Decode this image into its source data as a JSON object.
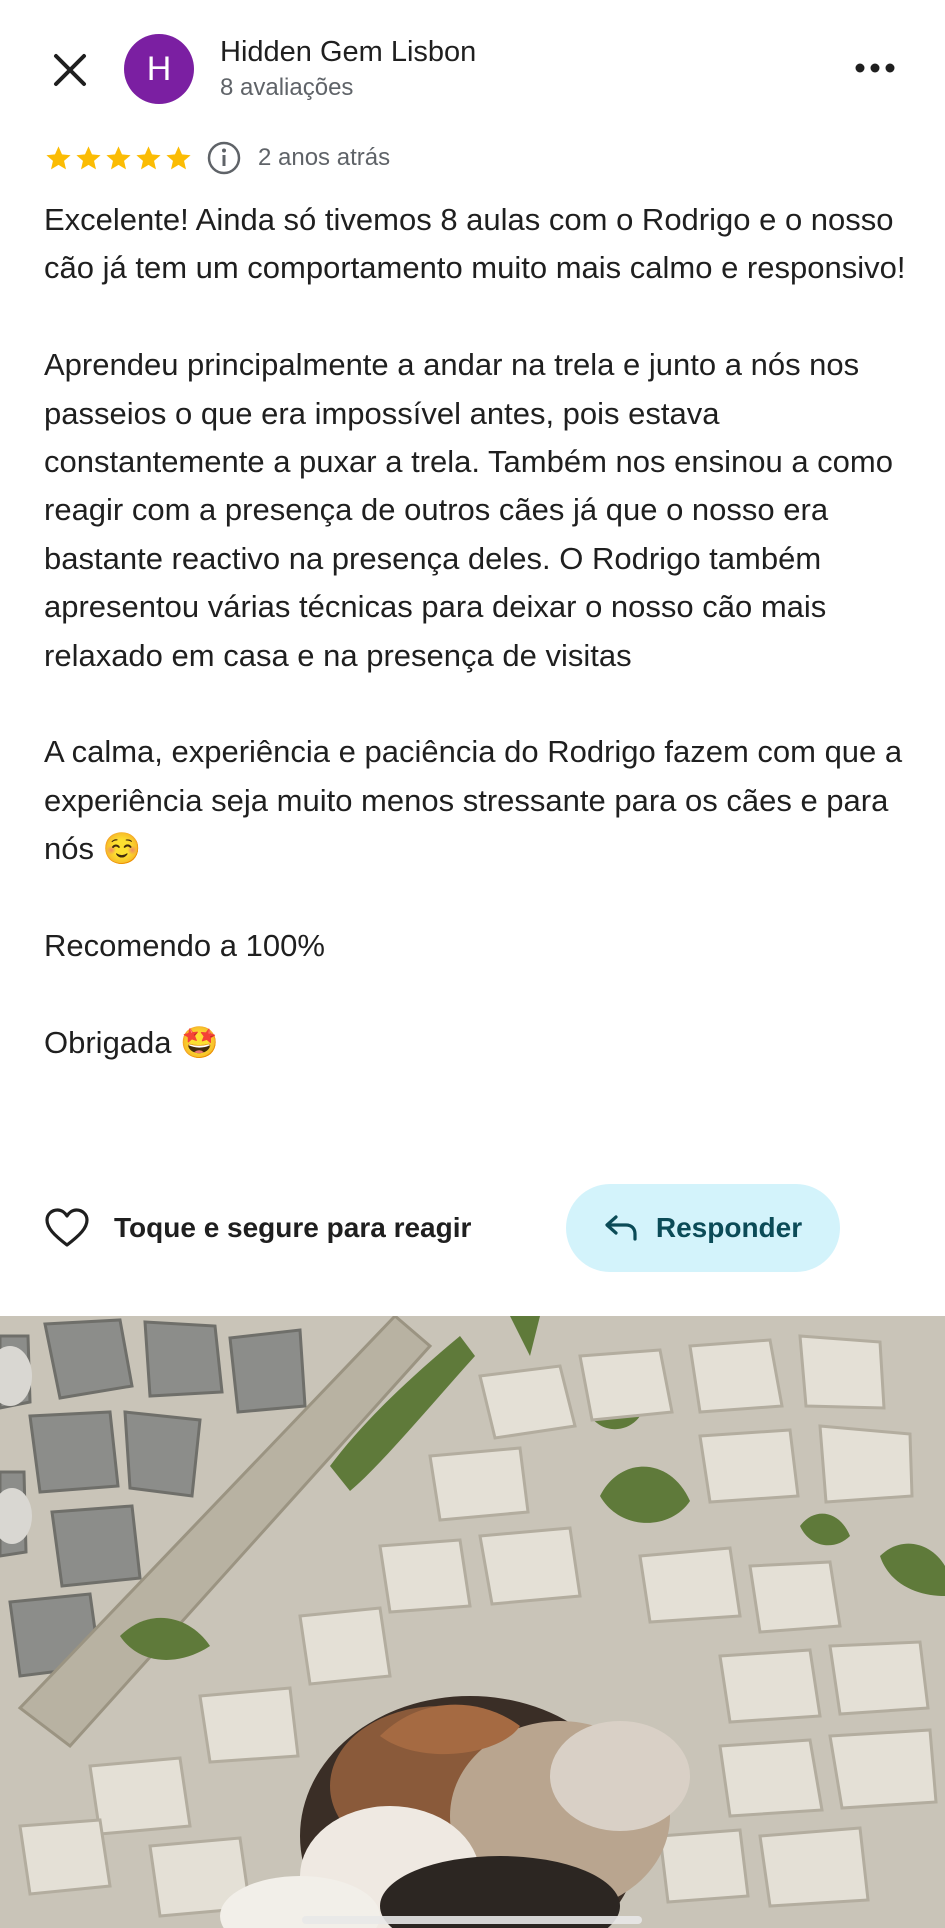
{
  "header": {
    "avatar_letter": "H",
    "reviewer_name": "Hidden Gem Lisbon",
    "review_count": "8 avaliações",
    "close_icon": "close-icon",
    "more_icon": "more-horizontal-icon"
  },
  "rating": {
    "stars": 5,
    "max_stars": 5,
    "date": "2 anos atrás",
    "star_color": "#fbbc04"
  },
  "review": {
    "text": "Excelente! Ainda só tivemos 8 aulas com o Rodrigo e o nosso cão já tem um comportamento muito mais calmo e responsivo!\n\nAprendeu principalmente a andar na trela e junto a nós nos passeios o que era impossível antes, pois estava constantemente a puxar a trela. Também nos ensinou a como reagir com a presença de outros cães já que o nosso era bastante reactivo na presença deles. O Rodrigo também apresentou várias técnicas para deixar o nosso cão mais relaxado em casa e na presença de visitas\n\nA calma, experiência e paciência do Rodrigo fazem com que a experiência seja muito menos stressante para os cães e para nós ☺️\n\nRecomendo a 100%\n\nObrigada 🤩"
  },
  "actions": {
    "react_label": "Toque e segure para reagir",
    "reply_label": "Responder",
    "reply_bg": "#d3f3fb"
  },
  "colors": {
    "avatar": "#7b1fa2",
    "secondary_text": "#5f6368"
  }
}
